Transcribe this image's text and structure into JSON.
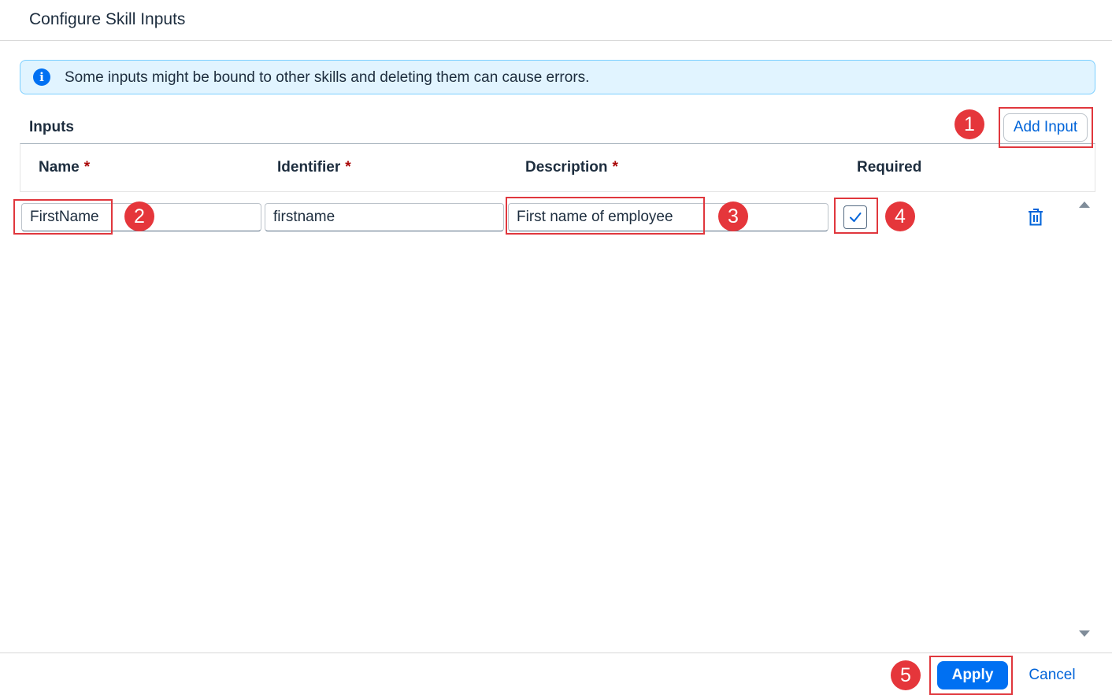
{
  "dialog": {
    "title": "Configure Skill Inputs"
  },
  "info": {
    "icon": "info-icon",
    "message": "Some inputs might be bound to other skills and deleting them can cause errors."
  },
  "inputs_section": {
    "label": "Inputs",
    "add_button_label": "Add Input"
  },
  "table": {
    "columns": [
      {
        "label": "Name",
        "required_mark": "*"
      },
      {
        "label": "Identifier",
        "required_mark": "*"
      },
      {
        "label": "Description",
        "required_mark": "*"
      },
      {
        "label": "Required"
      }
    ],
    "rows": [
      {
        "name": "FirstName",
        "identifier": "firstname",
        "description": "First name of employee",
        "required": true
      }
    ]
  },
  "footer": {
    "apply_label": "Apply",
    "cancel_label": "Cancel"
  },
  "annotations": [
    "1",
    "2",
    "3",
    "4",
    "5"
  ],
  "colors": {
    "accent": "#0070f2",
    "highlight": "#e0373d",
    "info_bg": "#e1f4ff",
    "required_star": "#aa0808"
  }
}
